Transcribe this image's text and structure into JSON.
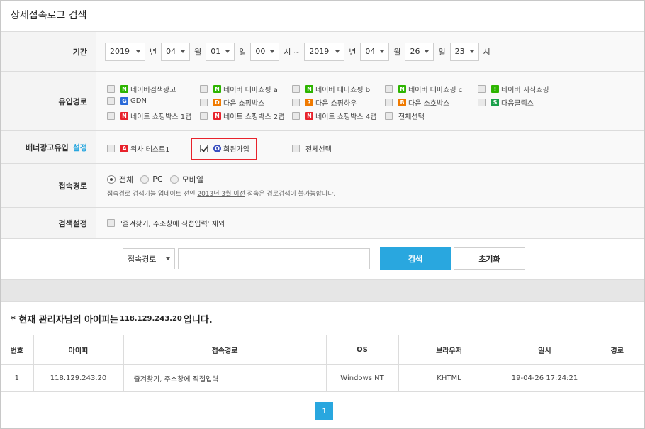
{
  "page": {
    "title": "상세접속로그 검색"
  },
  "period": {
    "label": "기간",
    "from": {
      "year": "2019",
      "year_unit": "년",
      "month": "04",
      "month_unit": "월",
      "day": "01",
      "day_unit": "일",
      "hour": "00",
      "hour_unit": "시 ~"
    },
    "to": {
      "year": "2019",
      "year_unit": "년",
      "month": "04",
      "month_unit": "월",
      "day": "26",
      "day_unit": "일",
      "hour": "23",
      "hour_unit": "시"
    }
  },
  "inflow": {
    "label": "유입경로",
    "items": [
      {
        "label": "네이버검색광고",
        "icon": "N",
        "color": "#2db400"
      },
      {
        "label": "네이버 테마쇼핑 a",
        "icon": "N",
        "color": "#2db400"
      },
      {
        "label": "네이버 테마쇼핑 b",
        "icon": "N",
        "color": "#2db400"
      },
      {
        "label": "네이버 테마쇼핑 c",
        "icon": "N",
        "color": "#2db400"
      },
      {
        "label": "네이버 지식쇼핑",
        "icon": "!",
        "color": "#2db400"
      },
      {
        "label": "GDN",
        "icon": "G",
        "color": "#2a6ad8"
      },
      {
        "label": "다음 쇼핑박스",
        "icon": "D",
        "color": "#f07a00"
      },
      {
        "label": "다음 쇼핑하우",
        "icon": "?",
        "color": "#f07a00"
      },
      {
        "label": "다음 소호박스",
        "icon": "B",
        "color": "#f07a00"
      },
      {
        "label": "다음클릭스",
        "icon": "S",
        "color": "#1aa04a"
      },
      {
        "label": "네이트 쇼핑박스 1탭",
        "icon": "N",
        "color": "#e8222b"
      },
      {
        "label": "네이트 쇼핑박스 2탭",
        "icon": "N",
        "color": "#e8222b"
      },
      {
        "label": "네이트 쇼핑박스 4탭",
        "icon": "N",
        "color": "#e8222b"
      },
      {
        "label": "전체선택",
        "icon": "",
        "color": ""
      }
    ]
  },
  "banner": {
    "label": "배너광고유입",
    "link": "설정",
    "items": [
      {
        "label": "위사 테스트1",
        "icon": "A",
        "color": "#e8222b",
        "checked": false
      },
      {
        "label": "회원가입",
        "icon": "O",
        "color": "#3a4fc0",
        "checked": true
      },
      {
        "label": "전체선택",
        "icon": "",
        "color": "",
        "checked": false
      }
    ]
  },
  "access": {
    "label": "접속경로",
    "options": [
      "전체",
      "PC",
      "모바일"
    ],
    "selected": "전체",
    "note_pre": "접속경로 검색기능 업데이트 전인 ",
    "note_link": "2013년 3월 이전",
    "note_post": " 접속은 경로검색이 불가능합니다."
  },
  "search_setting": {
    "label": "검색설정",
    "exclude": "'즐겨찾기, 주소창에 직접입력' 제외"
  },
  "search_bar": {
    "select": "접속경로",
    "input_value": "",
    "search_button": "검색",
    "reset_button": "초기화"
  },
  "ip_notice": {
    "prefix": "* 현재 관리자님의 아이피는 ",
    "ip": "118.129.243.20",
    "suffix": " 입니다."
  },
  "table": {
    "headers": [
      "번호",
      "아이피",
      "접속경로",
      "OS",
      "브라우저",
      "일시",
      "경로"
    ],
    "rows": [
      [
        "1",
        "118.129.243.20",
        "즐겨찾기, 주소창에 직접입력",
        "Windows NT",
        "KHTML",
        "19-04-26 17:24:21",
        ""
      ]
    ]
  },
  "pagination": {
    "current": "1"
  },
  "colors": {
    "accent": "#29a7df",
    "highlight": "#e8222b"
  }
}
